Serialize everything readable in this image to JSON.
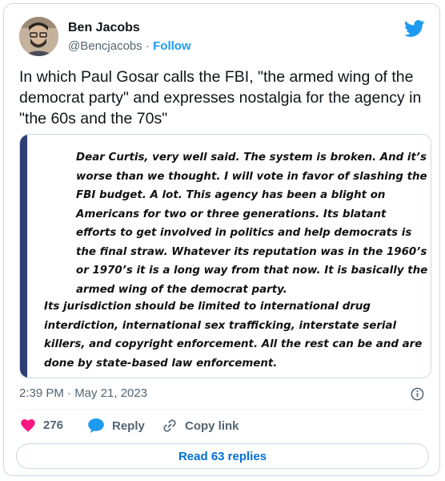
{
  "author": {
    "name": "Ben Jacobs",
    "handle": "@Bencjacobs",
    "separator": "·",
    "follow_label": "Follow"
  },
  "tweet": {
    "text": "In which Paul Gosar calls the FBI, \"the armed wing of the democrat party\" and expresses nostalgia for the agency in \"the 60s and the 70s\""
  },
  "quoted_image": {
    "paragraph1": "Dear Curtis, very well said.  The system is broken.  And it’s worse than we thought.  I will vote in favor of slashing the FBI budget.  A lot.  This agency has been a blight on Americans for two or three generations. Its blatant efforts to get involved in politics and help democrats is the final straw.  Whatever its reputation was in the 1960’s or 1970’s it is a long way from that now.  It is basically the armed wing of the democrat party.",
    "paragraph2": "Its jurisdiction should be limited to international drug interdiction, international sex trafficking, interstate serial killers, and copyright enforcement.  All the rest can be and are done by state-based law enforcement."
  },
  "meta": {
    "timestamp": "2:39 PM · May 21, 2023"
  },
  "actions": {
    "like_count": "276",
    "reply_label": "Reply",
    "copy_label": "Copy link"
  },
  "footer": {
    "read_replies_label": "Read 63 replies"
  },
  "colors": {
    "accent": "#1d9bf0",
    "like": "#f91880",
    "link": "#006fd6",
    "quote_bar": "#2e3e72",
    "muted": "#536471"
  },
  "icons": [
    "twitter-bird-icon",
    "info-icon",
    "heart-icon",
    "reply-bubble-icon",
    "link-icon"
  ]
}
